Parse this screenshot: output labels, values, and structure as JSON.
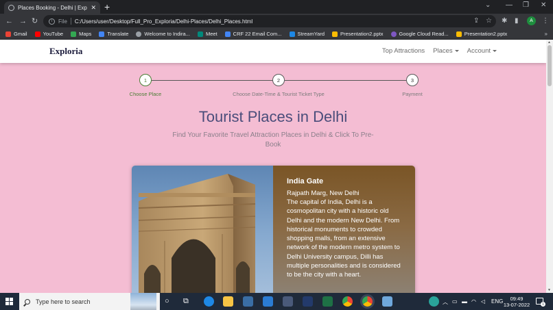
{
  "browser": {
    "tab_title": "Places Booking - Delhi | Exploria",
    "tab_close": "✕",
    "new_tab": "+",
    "scheme": "File",
    "url": "C:/Users/user/Desktop/Full_Pro_Exploria/Delhi-Places/Delhi_Places.html",
    "profile_initial": "A",
    "bookmarks": [
      {
        "label": "Gmail",
        "color": "#ea4335"
      },
      {
        "label": "YouTube",
        "color": "#ff0000"
      },
      {
        "label": "Maps",
        "color": "#34a853"
      },
      {
        "label": "Translate",
        "color": "#4285f4"
      },
      {
        "label": "Welcome to Indira...",
        "color": "#9aa0a6"
      },
      {
        "label": "Meet",
        "color": "#00897b"
      },
      {
        "label": "CRF 22 Email Com...",
        "color": "#4285f4"
      },
      {
        "label": "StreamYard",
        "color": "#1e88e5"
      },
      {
        "label": "Presentation2.pptx",
        "color": "#fbbc04"
      },
      {
        "label": "Google Cloud Read...",
        "color": "#7e57c2"
      },
      {
        "label": "Presentation2.pptx",
        "color": "#fbbc04"
      }
    ],
    "bookmarks_more": "»"
  },
  "site": {
    "brand": "Exploria",
    "nav": {
      "top_attractions": "Top Attractions",
      "places": "Places",
      "account": "Account"
    },
    "steps": [
      {
        "number": "1",
        "label": "Choose Place"
      },
      {
        "number": "2",
        "label": "Choose Date-Time & Tourist Ticket Type"
      },
      {
        "number": "3",
        "label": "Payment"
      }
    ],
    "heading": "Tourist Places in Delhi",
    "subheading": "Find Your Favorite Travel Attraction Places in Delhi & Click To Pre-Book",
    "card": {
      "title": "India Gate",
      "address": "Rajpath Marg, New Delhi",
      "description": "The capital of India, Delhi is a cosmopolitan city with a historic old Delhi and the modern New Delhi. From historical monuments to crowded shopping malls, from an extensive network of the modern metro system to Delhi University campus, Dilli has multiple personalities and is considered to be the city with a heart."
    }
  },
  "taskbar": {
    "search_placeholder": "Type here to search",
    "language": "ENG",
    "time": "09:49",
    "date": "13-07-2022",
    "notification_count": "1"
  },
  "colors": {
    "page_background": "#f4bdd3",
    "heading": "#4a4d7a",
    "active_step": "#4a7d34",
    "card_panel": "#7a5526"
  }
}
